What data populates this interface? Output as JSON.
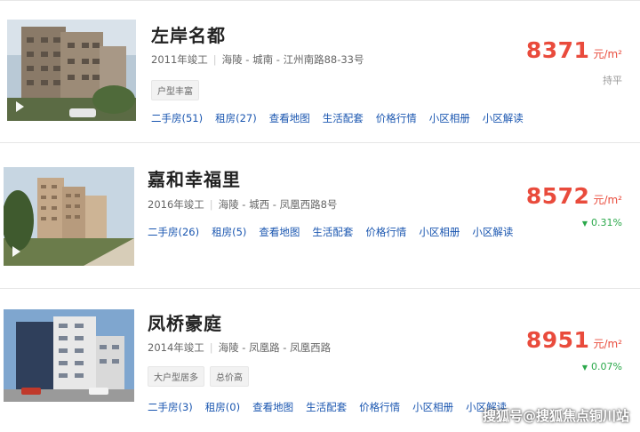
{
  "listings": [
    {
      "name": "左岸名都",
      "year": "2011年竣工",
      "location": "海陵 - 城南 - 江州南路88-33号",
      "tags": [
        "户型丰富"
      ],
      "links": [
        "二手房(51)",
        "租房(27)",
        "查看地图",
        "生活配套",
        "价格行情",
        "小区相册",
        "小区解读"
      ],
      "price": "8371",
      "unit": "元/m²",
      "trend": "持平",
      "trend_direction": "flat"
    },
    {
      "name": "嘉和幸福里",
      "year": "2016年竣工",
      "location": "海陵 - 城西 - 凤凰西路8号",
      "tags": [],
      "links": [
        "二手房(26)",
        "租房(5)",
        "查看地图",
        "生活配套",
        "价格行情",
        "小区相册",
        "小区解读"
      ],
      "price": "8572",
      "unit": "元/m²",
      "trend": "0.31%",
      "trend_direction": "up"
    },
    {
      "name": "凤桥豪庭",
      "year": "2014年竣工",
      "location": "海陵 - 凤凰路 - 凤凰西路",
      "tags": [
        "大户型居多",
        "总价高"
      ],
      "links": [
        "二手房(3)",
        "租房(0)",
        "查看地图",
        "生活配套",
        "价格行情",
        "小区相册",
        "小区解读"
      ],
      "price": "8951",
      "unit": "元/m²",
      "trend": "0.07%",
      "trend_direction": "up"
    }
  ],
  "watermark": "搜狐号@搜狐焦点铜川站",
  "colors": {
    "price": "#e94b3c",
    "link": "#1a56b0",
    "trend_up": "#2aa84a",
    "trend_flat": "#999999"
  }
}
